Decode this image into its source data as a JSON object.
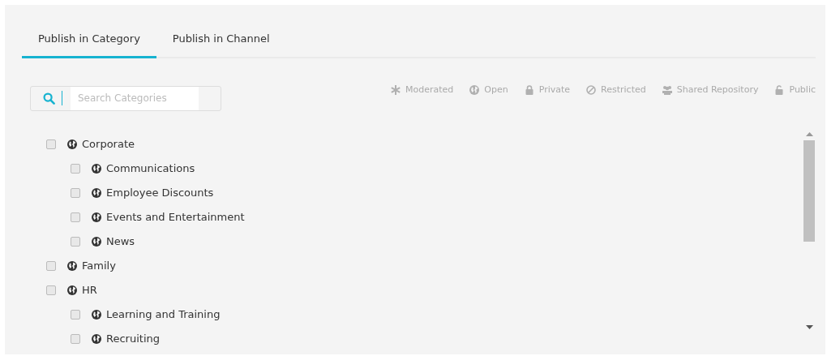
{
  "tabs": [
    {
      "label": "Publish in Category",
      "selected": true
    },
    {
      "label": "Publish in Channel",
      "selected": false
    }
  ],
  "search": {
    "placeholder": "Search Categories"
  },
  "legend": [
    {
      "kind": "moderated",
      "label": "Moderated"
    },
    {
      "kind": "open",
      "label": "Open"
    },
    {
      "kind": "private",
      "label": "Private"
    },
    {
      "kind": "restricted",
      "label": "Restricted"
    },
    {
      "kind": "shared",
      "label": "Shared Repository"
    },
    {
      "kind": "public",
      "label": "Public"
    }
  ],
  "categories": [
    {
      "label": "Corporate",
      "checked": false,
      "children": [
        {
          "label": "Communications",
          "checked": false
        },
        {
          "label": "Employee Discounts",
          "checked": false
        },
        {
          "label": "Events and Entertainment",
          "checked": false
        },
        {
          "label": "News",
          "checked": false
        }
      ]
    },
    {
      "label": "Family",
      "checked": false
    },
    {
      "label": "HR",
      "checked": false,
      "children": [
        {
          "label": "Learning and Training",
          "checked": false
        },
        {
          "label": "Recruiting",
          "checked": false
        }
      ]
    }
  ]
}
